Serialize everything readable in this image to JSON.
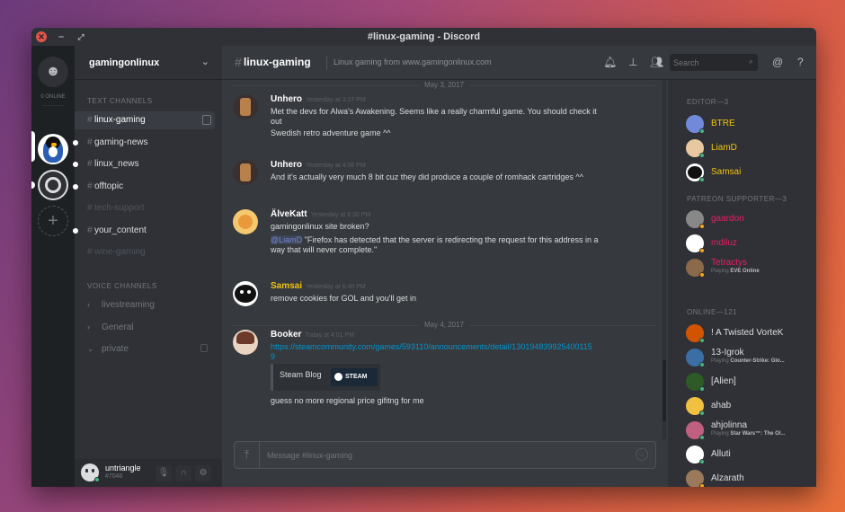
{
  "window": {
    "title": "#linux-gaming - Discord"
  },
  "servers": {
    "online_label": "0 ONLINE"
  },
  "guild": {
    "name": "gamingonlinux"
  },
  "text_channels_label": "TEXT CHANNELS",
  "text_channels": [
    {
      "name": "linux-gaming",
      "state": "active"
    },
    {
      "name": "gaming-news",
      "state": "unread"
    },
    {
      "name": "linux_news",
      "state": "unread"
    },
    {
      "name": "offtopic",
      "state": "unread"
    },
    {
      "name": "tech-support",
      "state": "muted"
    },
    {
      "name": "your_content",
      "state": "unread"
    },
    {
      "name": "wine-gaming",
      "state": "muted"
    }
  ],
  "voice_channels_label": "VOICE CHANNELS",
  "voice_channels": [
    {
      "name": "livestreaming"
    },
    {
      "name": "General"
    },
    {
      "name": "private"
    }
  ],
  "user": {
    "name": "untriangle",
    "tag": "#7046"
  },
  "channel": {
    "name": "linux-gaming",
    "topic": "Linux gaming from www.gamingonlinux.com"
  },
  "search": {
    "placeholder": "Search"
  },
  "day_dividers": [
    "May 3, 2017",
    "May 4, 2017"
  ],
  "messages": [
    {
      "author": "Unhero",
      "time": "Yesterday at 3:37 PM",
      "author_color": "#ffffff",
      "lines": [
        "Met the devs for Alwa's Awakening. Seems like a really charmful game. You should check it",
        "out",
        "Swedish retro adventure game ^^"
      ]
    },
    {
      "author": "Unhero",
      "time": "Yesterday at 4:06 PM",
      "author_color": "#ffffff",
      "lines": [
        "And it's actually very much 8 bit cuz they did produce a couple of romhack cartridges ^^"
      ]
    },
    {
      "author": "ÄlveKatt",
      "time": "Yesterday at 6:30 PM",
      "author_color": "#ffffff",
      "lines": [
        "gamingonlinux site broken?"
      ],
      "mention": "@LiamD",
      "quote": [
        "\"Firefox has detected that the server is redirecting the request for this address in a",
        "way that will never complete.\""
      ]
    },
    {
      "author": "Samsai",
      "time": "Yesterday at 6:40 PM",
      "author_color": "#f1c40f",
      "lines": [
        "remove cookies for GOL and you'll get in"
      ]
    },
    {
      "author": "Booker",
      "time": "Today at 4:01 PM",
      "author_color": "#ffffff",
      "link": [
        "https://steamcommunity.com/games/593110/announcements/detail/130194839925400115",
        "9"
      ],
      "embed_title": "Steam Blog",
      "embed_logo": "STEAM",
      "lines": [
        "guess no more regional price gifitng for me"
      ]
    }
  ],
  "composer": {
    "placeholder": "Message #linux-gaming"
  },
  "member_groups": [
    {
      "label": "EDITOR—3",
      "members": [
        {
          "name": "BTRE",
          "color": "#f1c40f",
          "status": "#43b581"
        },
        {
          "name": "LiamD",
          "color": "#f1c40f",
          "status": "#43b581"
        },
        {
          "name": "Samsai",
          "color": "#f1c40f",
          "status": "#43b581"
        }
      ]
    },
    {
      "label": "PATREON SUPPORTER—3",
      "members": [
        {
          "name": "gaardon",
          "color": "#e91e63",
          "status": "#faa61a"
        },
        {
          "name": "mdiluz",
          "color": "#e91e63",
          "status": "#faa61a"
        },
        {
          "name": "Tetractys",
          "color": "#e91e63",
          "status": "#faa61a",
          "playing": "Playing",
          "game": "EVE Online"
        }
      ]
    },
    {
      "label": "ONLINE—121",
      "members": [
        {
          "name": "! A Twisted VorteK",
          "color": "#dcddde",
          "status": "#43b581"
        },
        {
          "name": "13-Igrok",
          "color": "#dcddde",
          "status": "#43b581",
          "playing": "Playing",
          "game": "Counter-Strike: Glo..."
        },
        {
          "name": "[Alien]",
          "color": "#dcddde",
          "status": "#43b581"
        },
        {
          "name": "ahab",
          "color": "#dcddde",
          "status": "#43b581"
        },
        {
          "name": "ahjolinna",
          "color": "#dcddde",
          "status": "#43b581",
          "playing": "Playing",
          "game": "Star Wars™: The Ol..."
        },
        {
          "name": "Alluti",
          "color": "#dcddde",
          "status": "#43b581"
        },
        {
          "name": "Alzarath",
          "color": "#dcddde",
          "status": "#faa61a"
        }
      ]
    }
  ]
}
